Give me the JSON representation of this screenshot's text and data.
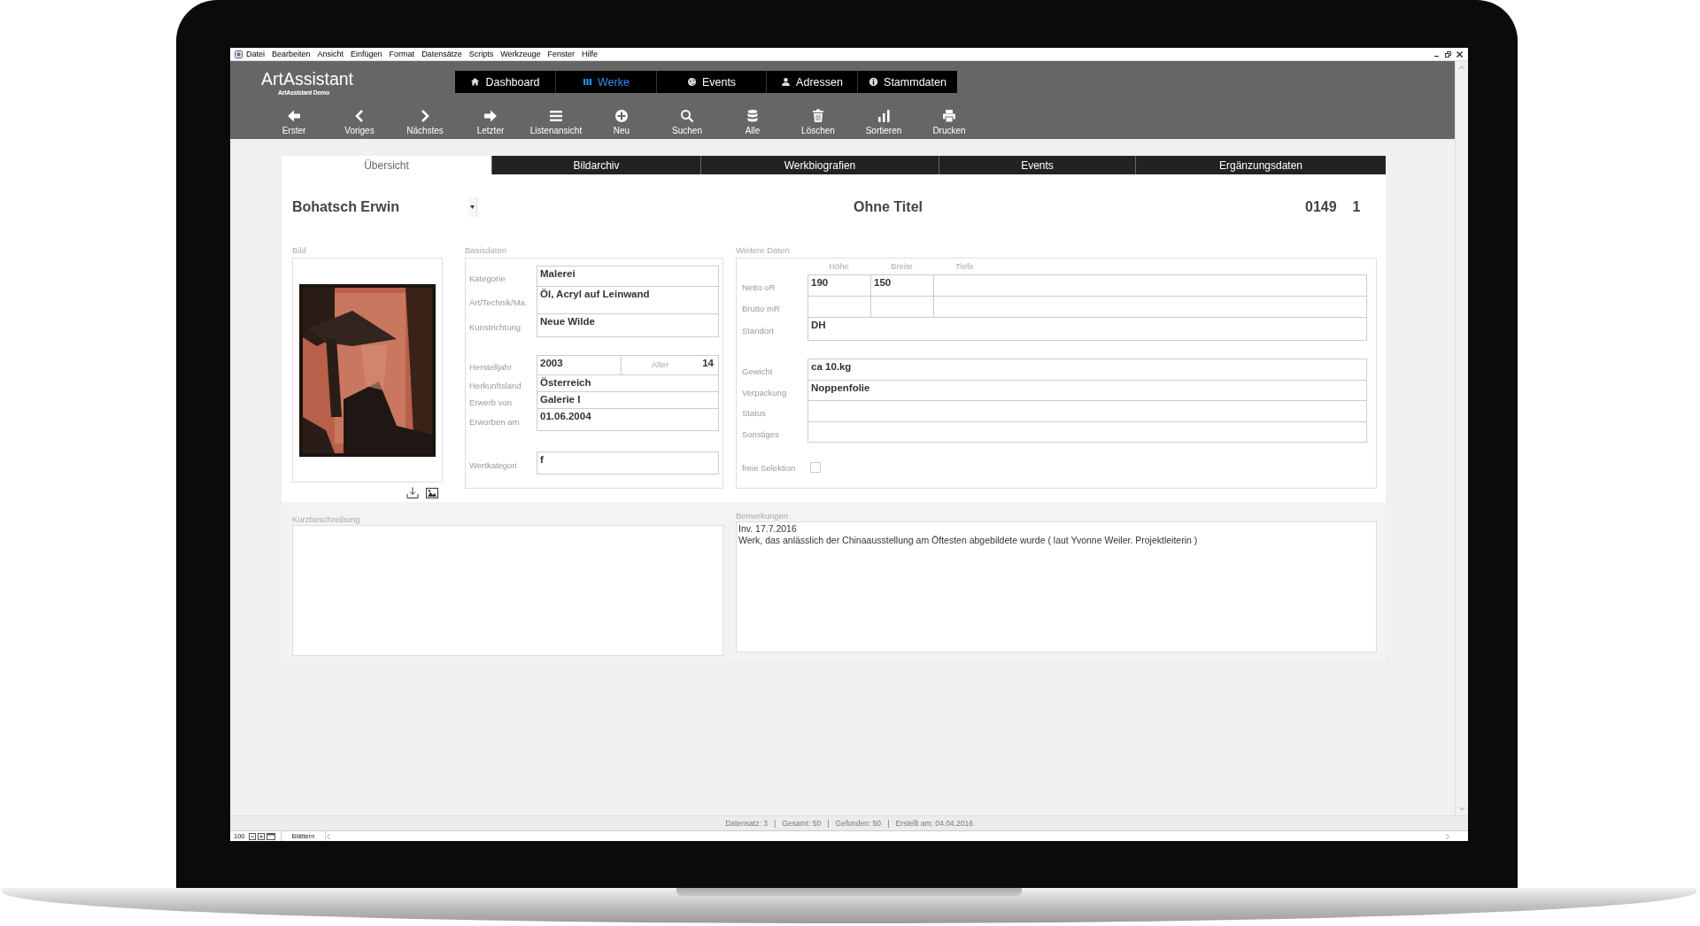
{
  "menu_bar": [
    "Datei",
    "Bearbeiten",
    "Ansicht",
    "Einfügen",
    "Format",
    "Datensätze",
    "Scripts",
    "Werkzeuge",
    "Fenster",
    "Hilfe"
  ],
  "app": {
    "title": "ArtAssistant",
    "subtitle": "ArtAssistant Demo"
  },
  "nav_tabs": [
    {
      "label": "Dashboard",
      "selected": false
    },
    {
      "label": "Werke",
      "selected": true
    },
    {
      "label": "Events",
      "selected": false
    },
    {
      "label": "Adressen",
      "selected": false
    },
    {
      "label": "Stammdaten",
      "selected": false
    }
  ],
  "toolbar": [
    "Erster",
    "Voriges",
    "Nächstes",
    "Letzter",
    "Listenansicht",
    "Neu",
    "Suchen",
    "Alle",
    "Löschen",
    "Sortieren",
    "Drucken"
  ],
  "form_tabs": [
    {
      "label": "Übersicht",
      "selected": true
    },
    {
      "label": "Bildarchiv",
      "selected": false
    },
    {
      "label": "Werkbiografien",
      "selected": false
    },
    {
      "label": "Events",
      "selected": false
    },
    {
      "label": "Ergänzungsdaten",
      "selected": false
    }
  ],
  "record": {
    "artist": "Bohatsch Erwin",
    "title": "Ohne Titel",
    "number": "0149",
    "copy": "1"
  },
  "image_section": {
    "label": "Bild"
  },
  "basisdaten": {
    "label": "Basisdaten",
    "groups": [
      [
        {
          "label": "Kategorie",
          "value": "Malerei"
        },
        {
          "label": "Art/Technik/Ma.",
          "value": "Öl, Acryl auf Leinwand"
        },
        {
          "label": "Kunstrichtung",
          "value": "Neue Wilde"
        }
      ],
      [
        {
          "label": "Herstelljahr",
          "value": "2003",
          "extra_label": "Alter",
          "extra_value": "14"
        },
        {
          "label": "Herkunftsland",
          "value": "Österreich"
        },
        {
          "label": "Erwerb von",
          "value": "Galerie I"
        },
        {
          "label": "Erworben am",
          "value": "01.06.2004"
        }
      ],
      [
        {
          "label": "Wertkategori",
          "value": "f"
        }
      ]
    ]
  },
  "weitere_daten": {
    "label": "Weitere Daten",
    "dimension_columns": [
      "Höhe",
      "Breite",
      "Tiefe"
    ],
    "dimension_rows": [
      {
        "label": "Netto oR",
        "values": [
          "190",
          "150"
        ]
      },
      {
        "label": "Brutto mR"
      }
    ],
    "groups": [
      [
        {
          "label": "Standort",
          "value": "DH"
        }
      ],
      [
        {
          "label": "Gewicht",
          "value": "ca 10.kg"
        },
        {
          "label": "Verpackung",
          "value": "Noppenfolie"
        },
        {
          "label": "Status"
        },
        {
          "label": "Sonstiges"
        }
      ]
    ],
    "checkbox": {
      "label": "freie Selektion",
      "checked": false
    }
  },
  "kurzbeschreibung": {
    "label": "Kurzbeschreibung"
  },
  "bemerkungen": {
    "label": "Bemerkungen",
    "lines": [
      "Inv. 17.7.2016",
      "Werk, das anlässlich der Chinaausstellung am Öftesten abgebildete wurde ( laut Yvonne Weiler. Projektleiterin )"
    ]
  },
  "status_bar": {
    "text": "Datensatz: 3   |   Gesamt: 50   |   Gefunden: 50   |   Erstellt am: 04.04.2016"
  },
  "bottom_bar": {
    "zoom": "100",
    "mode": "Blättern"
  }
}
